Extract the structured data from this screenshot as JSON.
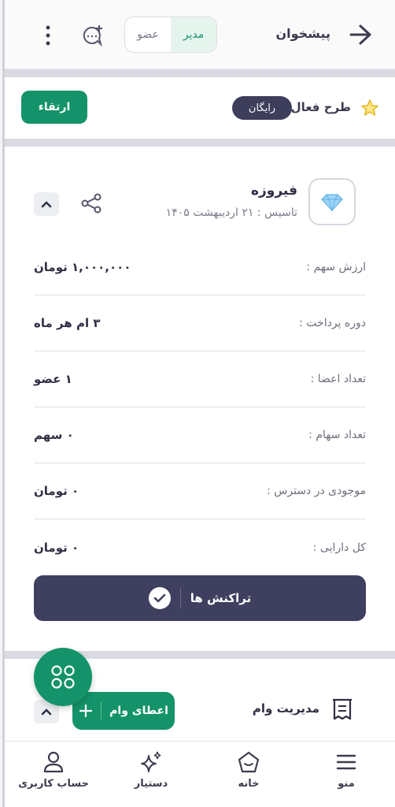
{
  "header": {
    "title": "پیشخوان",
    "toggle": {
      "admin": "مدیر",
      "member": "عضو"
    },
    "icons": {
      "back": "arrow-right-icon",
      "chat": "chat-add-icon",
      "more": "more-vertical-icon"
    }
  },
  "plan": {
    "label": "طرح فعال",
    "badge": "رایگان",
    "upgrade": "ارتقاء"
  },
  "fund": {
    "name": "فیروزه",
    "founded": "تاسیس : ۲۱ اردیبهشت ۱۴۰۵",
    "rows": [
      {
        "key": "ارزش سهم :",
        "value": "۱,۰۰۰,۰۰۰ تومان"
      },
      {
        "key": "دوره پرداخت :",
        "value": "۳ ام هر ماه"
      },
      {
        "key": "تعداد اعضا :",
        "value": "۱ عضو"
      },
      {
        "key": "تعداد سهام :",
        "value": "۰ سهم"
      },
      {
        "key": "موجودی در دسترس :",
        "value": "۰ تومان"
      },
      {
        "key": "کل دارایی :",
        "value": "۰ تومان"
      }
    ],
    "transactions_button": "تراکنش ها"
  },
  "loan": {
    "label": "مدیریت وام",
    "give_button": "اعطای وام"
  },
  "nav": {
    "menu": "منو",
    "home": "خانه",
    "assistant": "دستیار",
    "account": "حساب کاربری"
  },
  "colors": {
    "brand": "#14936a",
    "dark": "#3f3f5f"
  }
}
